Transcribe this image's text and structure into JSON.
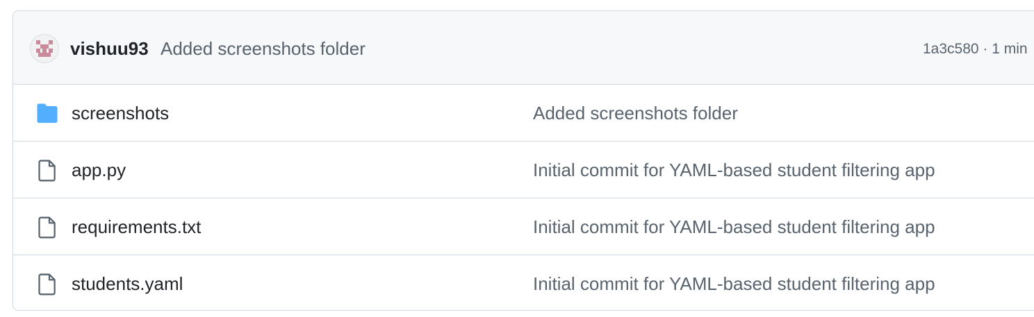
{
  "latest_commit": {
    "author": "vishuu93",
    "message": "Added screenshots folder",
    "meta": "1a3c580 · 1 min"
  },
  "files": [
    {
      "name": "screenshots",
      "type": "folder",
      "icon": "folder-icon",
      "message": "Added screenshots folder"
    },
    {
      "name": "app.py",
      "type": "file",
      "icon": "file-icon",
      "message": "Initial commit for YAML-based student filtering app"
    },
    {
      "name": "requirements.txt",
      "type": "file",
      "icon": "file-icon",
      "message": "Initial commit for YAML-based student filtering app"
    },
    {
      "name": "students.yaml",
      "type": "file",
      "icon": "file-icon",
      "message": "Initial commit for YAML-based student filtering app"
    }
  ],
  "colors": {
    "folder": "#54aeff",
    "file_icon": "#59636e",
    "header_bg": "#f6f8fa",
    "border": "#d0d7de"
  }
}
